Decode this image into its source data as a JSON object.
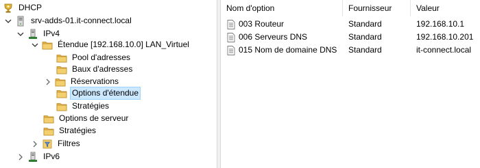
{
  "tree": {
    "root": {
      "label": "DHCP",
      "icon": "dhcp-icon"
    },
    "server": {
      "label": "srv-adds-01.it-connect.local",
      "icon": "server-icon"
    },
    "ipv4": {
      "label": "IPv4",
      "icon": "ipv4-icon"
    },
    "scope": {
      "label": "Étendue [192.168.10.0] LAN_Virtuel",
      "icon": "folder-icon"
    },
    "scope_children": [
      {
        "label": "Pool d'adresses",
        "icon": "folder-icon"
      },
      {
        "label": "Baux d'adresses",
        "icon": "folder-icon"
      },
      {
        "label": "Réservations",
        "icon": "folder-icon"
      },
      {
        "label": "Options d'étendue",
        "icon": "folder-icon",
        "selected": true
      },
      {
        "label": "Stratégies",
        "icon": "folder-icon"
      }
    ],
    "ipv4_children": [
      {
        "label": "Options de serveur",
        "icon": "folder-icon"
      },
      {
        "label": "Stratégies",
        "icon": "folder-icon"
      },
      {
        "label": "Filtres",
        "icon": "filter-icon"
      }
    ],
    "ipv6": {
      "label": "IPv6",
      "icon": "ipv6-icon"
    }
  },
  "list": {
    "columns": [
      "Nom d'option",
      "Fournisseur",
      "Valeur"
    ],
    "rows": [
      {
        "name": "003 Routeur",
        "vendor": "Standard",
        "value": "192.168.10.1"
      },
      {
        "name": "006 Serveurs DNS",
        "vendor": "Standard",
        "value": "192.168.10.201"
      },
      {
        "name": "015 Nom de domaine DNS",
        "vendor": "Standard",
        "value": "it-connect.local"
      }
    ]
  },
  "colors": {
    "selection_bg": "#cce8ff",
    "selection_border": "#99d1ff",
    "folder": "#e8b84a"
  }
}
